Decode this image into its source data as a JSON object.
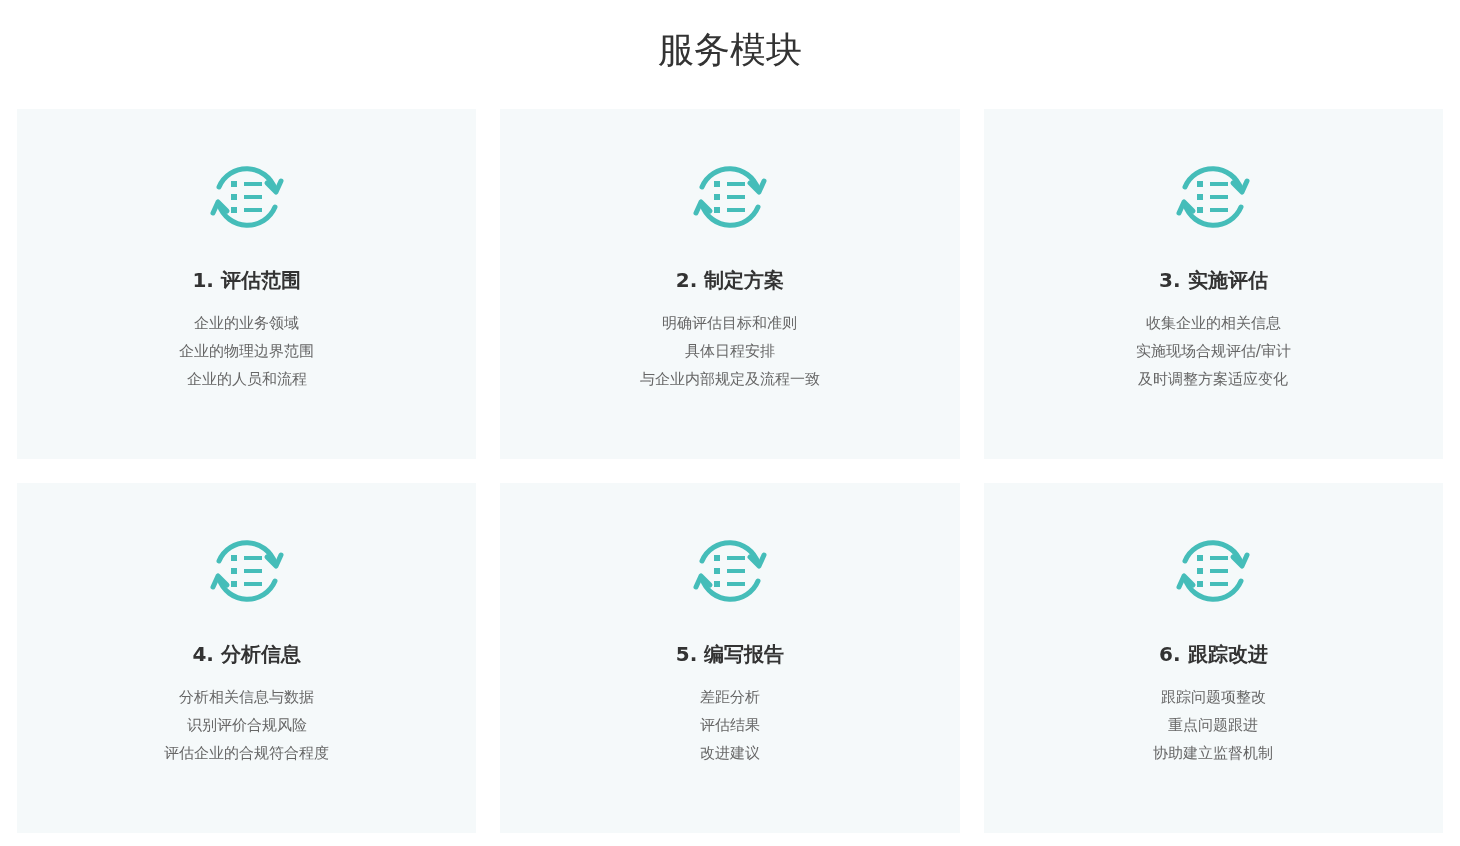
{
  "title": "服务模块",
  "modules": [
    {
      "heading": "1. 评估范围",
      "items": [
        "企业的业务领域",
        "企业的物理边界范围",
        "企业的人员和流程"
      ]
    },
    {
      "heading": "2. 制定方案",
      "items": [
        "明确评估目标和准则",
        "具体日程安排",
        "与企业内部规定及流程一致"
      ]
    },
    {
      "heading": "3. 实施评估",
      "items": [
        "收集企业的相关信息",
        "实施现场合规评估/审计",
        "及时调整方案适应变化"
      ]
    },
    {
      "heading": "4. 分析信息",
      "items": [
        "分析相关信息与数据",
        "识别评价合规风险",
        "评估企业的合规符合程度"
      ]
    },
    {
      "heading": "5. 编写报告",
      "items": [
        "差距分析",
        "评估结果",
        "改进建议"
      ]
    },
    {
      "heading": "6. 跟踪改进",
      "items": [
        "跟踪问题项整改",
        "重点问题跟进",
        "协助建立监督机制"
      ]
    }
  ]
}
